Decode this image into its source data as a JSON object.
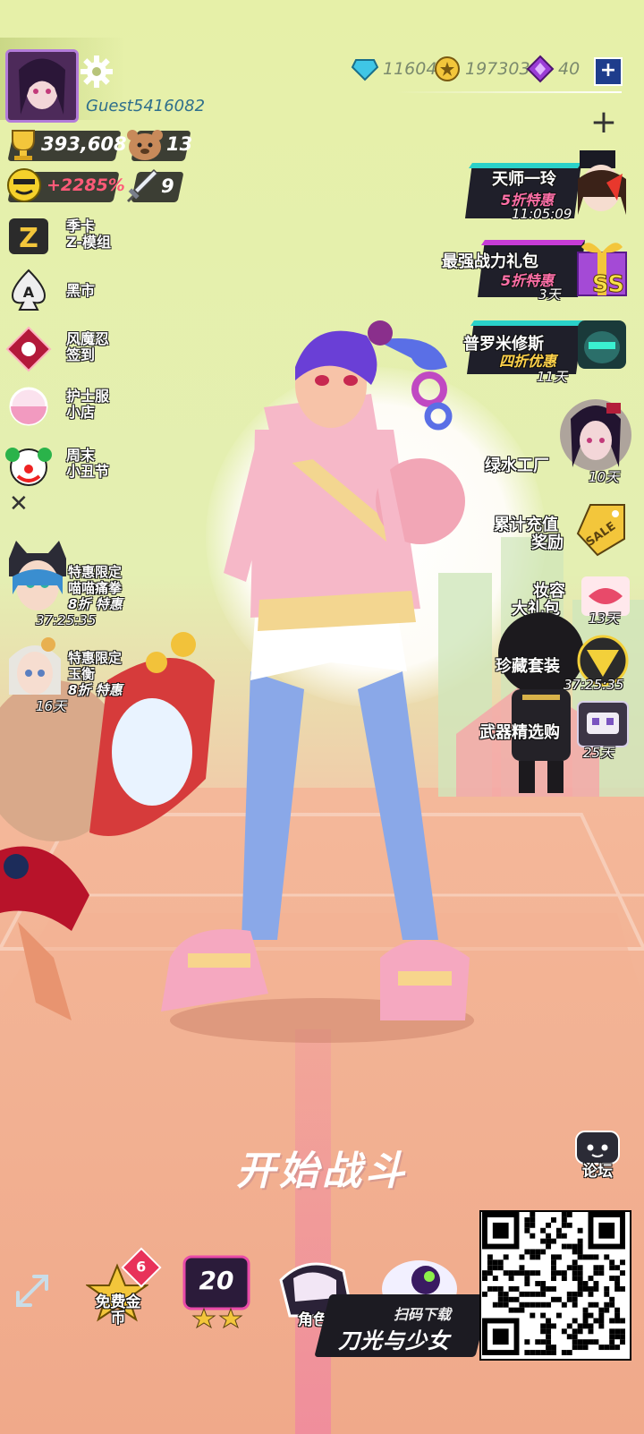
{
  "player": {
    "name": "Guest5416082",
    "trophies": "393,608",
    "bear_count": "13",
    "bonus": "+2285%",
    "swords": "9"
  },
  "currency": {
    "gems": "11604",
    "coins": "197303",
    "crystals": "40",
    "add_label": "+"
  },
  "left_menu": [
    {
      "label_line1": "季卡",
      "label_line2": "Z-模组",
      "icon": "z-badge-icon"
    },
    {
      "label_line1": "黑市",
      "label_line2": "",
      "icon": "spade-icon"
    },
    {
      "label_line1": "风魔忍",
      "label_line2": "签到",
      "icon": "shuriken-icon"
    },
    {
      "label_line1": "护士服",
      "label_line2": "小店",
      "icon": "capsule-icon"
    },
    {
      "label_line1": "周末",
      "label_line2": "小丑节",
      "icon": "clown-icon"
    }
  ],
  "close_label": "✕",
  "left_promos": [
    {
      "line1": "特惠限定",
      "line2": "喵喵痛拳",
      "line3": "8折 特惠",
      "timer": "37:25:35"
    },
    {
      "line1": "特惠限定",
      "line2": "玉衡",
      "line3": "8折 特惠",
      "timer": "16天"
    }
  ],
  "right_promos": [
    {
      "title": "天师一玲",
      "badge": "5折特惠",
      "sub": "11:05:09"
    },
    {
      "title": "最强战力礼包",
      "badge": "5折特惠",
      "sub": "3天",
      "tag": "SS"
    },
    {
      "title": "普罗米修斯",
      "badge": "四折优惠",
      "sub": "11天"
    },
    {
      "title": "绿水工厂",
      "badge": "",
      "sub": "10天"
    },
    {
      "title": "累计充值",
      "badge": "奖励",
      "sub": "",
      "tag": "SALE"
    },
    {
      "title": "妆容",
      "badge": "大礼包",
      "sub": "13天"
    },
    {
      "title": "珍藏套装",
      "badge": "",
      "sub": "37:25:35"
    },
    {
      "title": "武器精选购",
      "badge": "",
      "sub": "25天"
    }
  ],
  "start_button": "开始战斗",
  "forum_label": "论坛",
  "bottom": {
    "free_coins_label": "免费金币",
    "free_coins_count": "6",
    "level": "20",
    "role_label": "角色",
    "banner_top": "扫码下载",
    "banner_main": "刀光与少女"
  },
  "colors": {
    "bg_top": "#e6f0a8",
    "bg_bottom": "#eea57f",
    "accent_purple": "#8a3dbf",
    "accent_blue": "#1e3d8c"
  }
}
